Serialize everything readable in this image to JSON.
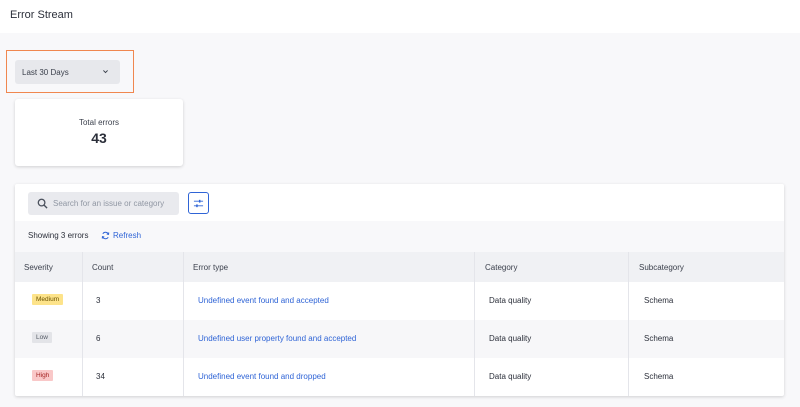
{
  "page": {
    "title": "Error Stream"
  },
  "filters": {
    "date_range": "Last 30 Days"
  },
  "summary": {
    "label": "Total errors",
    "value": "43"
  },
  "search": {
    "placeholder": "Search for an issue or category"
  },
  "status": {
    "showing": "Showing 3 errors",
    "refresh": "Refresh"
  },
  "table": {
    "headers": [
      "Severity",
      "Count",
      "Error type",
      "Category",
      "Subcategory"
    ],
    "rows": [
      {
        "severity": "Medium",
        "count": "3",
        "error_type": "Undefined event found and accepted",
        "category": "Data quality",
        "subcategory": "Schema"
      },
      {
        "severity": "Low",
        "count": "6",
        "error_type": "Undefined user property found and accepted",
        "category": "Data quality",
        "subcategory": "Schema"
      },
      {
        "severity": "High",
        "count": "34",
        "error_type": "Undefined event found and dropped",
        "category": "Data quality",
        "subcategory": "Schema"
      }
    ]
  },
  "icons": {
    "dropdown": "chevron-down-icon",
    "search": "search-icon",
    "filter": "sliders-icon",
    "refresh": "refresh-icon"
  },
  "colors": {
    "accent": "#2f64d6",
    "focus_outline": "#f0874f",
    "medium": "#fde38a",
    "low": "#e3e4e8",
    "high": "#f9c8c8"
  }
}
